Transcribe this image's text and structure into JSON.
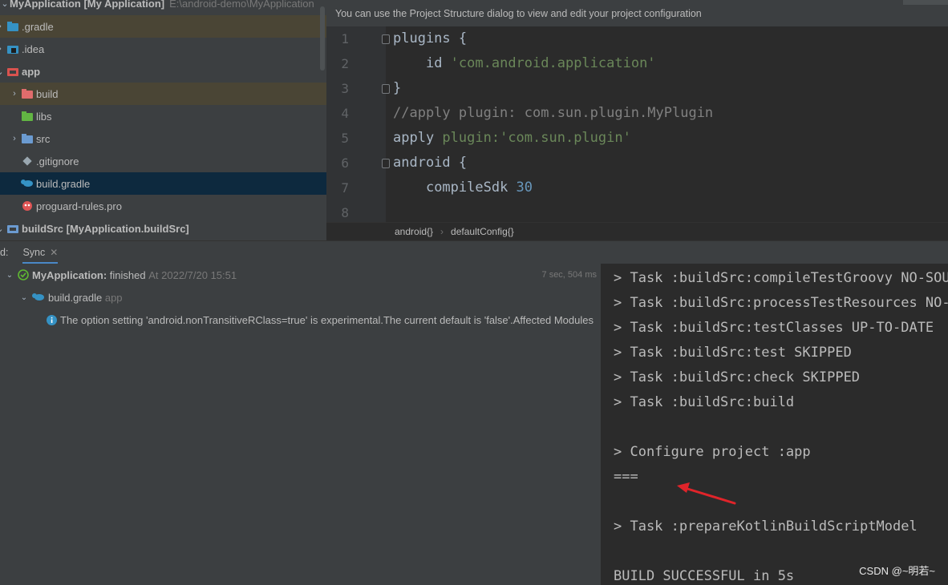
{
  "project": {
    "name": "MyApplication",
    "name_bracket": "[My Application]",
    "path": "E:\\android-demo\\MyApplication",
    "items": [
      {
        "label": ".gradle",
        "icon": "folder-gradle-icon"
      },
      {
        "label": ".idea",
        "icon": "folder-idea-icon"
      },
      {
        "label": "app",
        "icon": "module-folder-icon"
      },
      {
        "label": "build",
        "icon": "build-folder-icon"
      },
      {
        "label": "libs",
        "icon": "folder-libs-icon"
      },
      {
        "label": "src",
        "icon": "folder-src-icon"
      },
      {
        "label": ".gitignore",
        "icon": "gitignore-icon"
      },
      {
        "label": "build.gradle",
        "icon": "gradle-elephant-icon"
      },
      {
        "label": "proguard-rules.pro",
        "icon": "proguard-icon"
      },
      {
        "label": "buildSrc",
        "bracket": "[MyApplication.buildSrc]",
        "icon": "module-folder-icon"
      }
    ]
  },
  "editor": {
    "banner": "You can use the Project Structure dialog to view and edit your project configuration",
    "line_numbers": [
      "1",
      "2",
      "3",
      "4",
      "5",
      "6",
      "7",
      "8"
    ],
    "lines": {
      "l1": "plugins {",
      "l2_kw": "id ",
      "l2_str": "'com.android.application'",
      "l3": "}",
      "l4": "//apply plugin: com.sun.plugin.MyPlugin",
      "l5_kw": "apply ",
      "l5_named": "plugin:",
      "l5_str": "'com.sun.plugin'",
      "l6": "android {",
      "l7_kw": "compileSdk ",
      "l7_num": "30"
    },
    "breadcrumbs": [
      "android{}",
      "defaultConfig{}"
    ]
  },
  "build_window": {
    "prefix": "d:",
    "tab": "Sync",
    "tree": {
      "root_name": "MyApplication:",
      "root_status": "finished",
      "root_time": "At 2022/7/20 15:51",
      "root_duration": "7 sec, 504 ms",
      "child_name": "build.gradle",
      "child_module": "app",
      "message": "The option setting 'android.nonTransitiveRClass=true' is experimental.The current default is 'false'.Affected Modules"
    },
    "console": [
      "> Task :buildSrc:compileTestGroovy NO-SOURCE",
      "> Task :buildSrc:processTestResources NO-SOURCE",
      "> Task :buildSrc:testClasses UP-TO-DATE",
      "> Task :buildSrc:test SKIPPED",
      "> Task :buildSrc:check SKIPPED",
      "> Task :buildSrc:build",
      "",
      "> Configure project :app",
      "===",
      "",
      "> Task :prepareKotlinBuildScriptModel",
      "",
      "BUILD SUCCESSFUL in 5s"
    ]
  },
  "watermark": "CSDN @~明若~",
  "colors": {
    "accent": "#4a88c7",
    "annotation_arrow": "#e0242a",
    "success": "#5fb832",
    "string": "#6a8759",
    "number": "#6897bb"
  }
}
